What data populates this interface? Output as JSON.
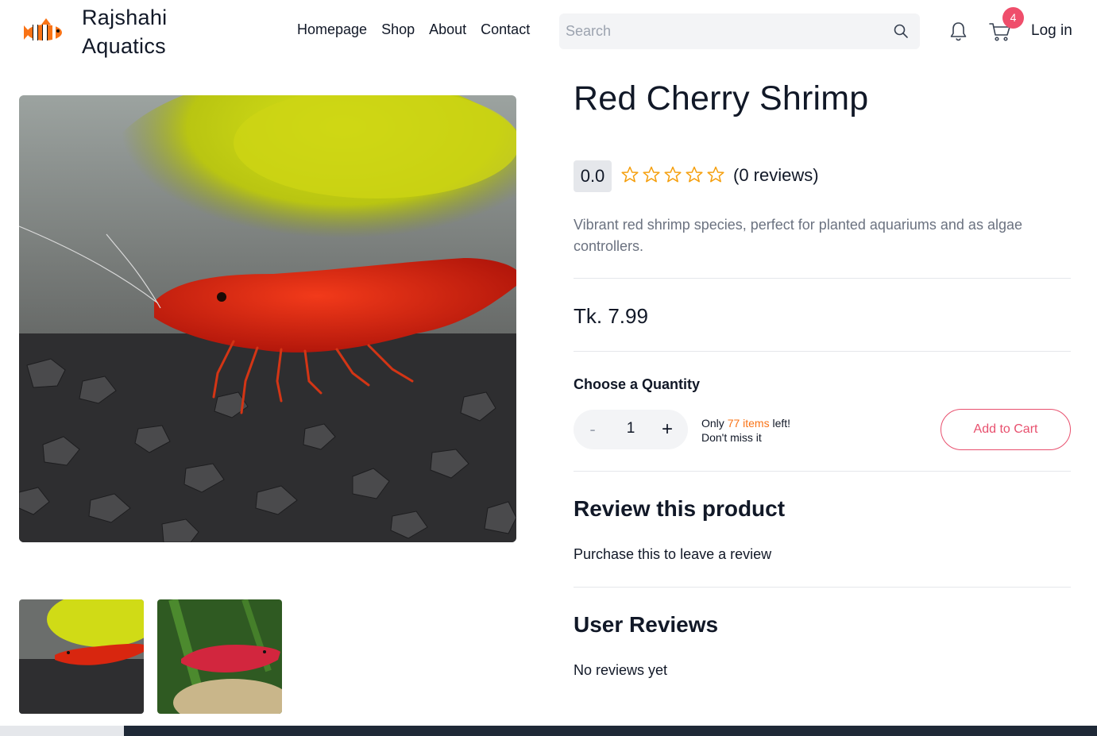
{
  "header": {
    "brand": "Rajshahi\nAquatics",
    "brand_line1": "Rajshahi",
    "brand_line2": "Aquatics",
    "nav": [
      "Homepage",
      "Shop",
      "About",
      "Contact"
    ],
    "search_placeholder": "Search",
    "cart_count": "4",
    "login_label": "Log in"
  },
  "product": {
    "title": "Red Cherry Shrimp",
    "rating": "0.0",
    "stars_filled": 0,
    "stars_total": 5,
    "reviews_label": "(0 reviews)",
    "description": "Vibrant red shrimp species, perfect for planted aquariums and as algae controllers.",
    "price": "Tk. 7.99",
    "quantity_label": "Choose a Quantity",
    "quantity": "1",
    "minus_label": "-",
    "plus_label": "+",
    "stock_prefix": "Only ",
    "stock_highlight": "77 items",
    "stock_suffix": " left!",
    "stock_line2": "Don't miss it",
    "add_to_cart_label": "Add to Cart"
  },
  "review_section": {
    "heading": "Review this product",
    "text": "Purchase this to leave a review"
  },
  "user_reviews": {
    "heading": "User Reviews",
    "text": "No reviews yet"
  },
  "colors": {
    "accent": "#e8506e",
    "badge": "#ef4e6b",
    "star": "#f59e0b",
    "stock_highlight": "#f97316"
  }
}
